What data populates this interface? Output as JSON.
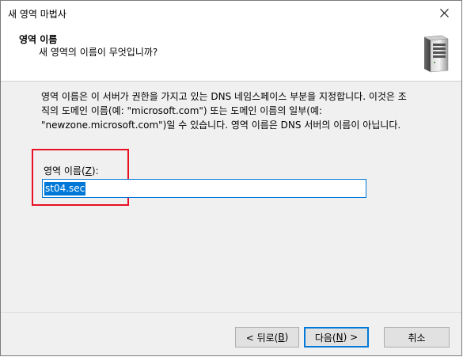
{
  "window": {
    "title": "새 영역 마법사"
  },
  "header": {
    "title": "영역 이름",
    "subtitle": "새 영역의 이름이 무엇입니까?"
  },
  "description": {
    "line1": "영역 이름은 이 서버가 권한을 가지고 있는 DNS 네임스페이스 부분을 지정합니다. 이것은 조",
    "line2": "직의 도메인 이름(예: \"microsoft.com\") 또는 도메인 이름의 일부(예:",
    "line3": "\"newzone.microsoft.com\")일 수 있습니다. 영역 이름은 DNS 서버의 이름이 아닙니다."
  },
  "zone_name": {
    "label_prefix": "영역 이름(",
    "label_mnemonic": "Z",
    "label_suffix": "):",
    "value": "st04.sec"
  },
  "buttons": {
    "back_prefix": "< 뒤로(",
    "back_mnemonic": "B",
    "back_suffix": ")",
    "next_prefix": "다음(",
    "next_mnemonic": "N",
    "next_suffix": ") >",
    "cancel": "취소"
  },
  "colors": {
    "accent": "#0078d7",
    "highlight": "#e81123"
  },
  "icons": [
    "close-icon",
    "server-icon"
  ]
}
